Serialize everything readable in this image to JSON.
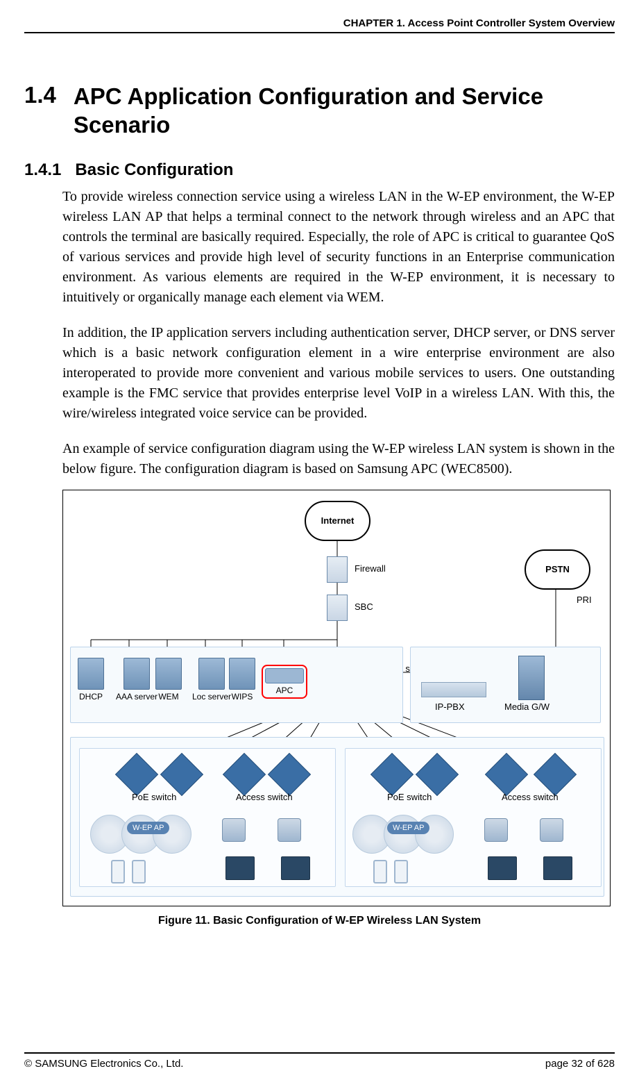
{
  "header": {
    "chapter": "CHAPTER 1. Access Point Controller System Overview"
  },
  "section": {
    "number": "1.4",
    "title": "APC Application Configuration and Service Scenario"
  },
  "subsection": {
    "number": "1.4.1",
    "title": "Basic Configuration"
  },
  "paragraphs": {
    "p1": "To provide wireless connection service using a wireless LAN in the W-EP environment, the W-EP wireless LAN AP that helps a terminal connect to the network through wireless and an APC that controls the terminal are basically required. Especially, the role of APC is critical to guarantee QoS of various services and provide high level of security functions in an Enterprise communication environment. As various elements are required in the W-EP environment, it is necessary to intuitively or organically manage each element via WEM.",
    "p2": "In addition, the IP application servers including authentication server, DHCP server, or DNS server which is a basic network configuration element in a wire enterprise environment are also interoperated to provide more convenient and various mobile services to users. One outstanding example is the FMC service that provides enterprise level VoIP in a wireless LAN. With this, the wire/wireless integrated voice service can be provided.",
    "p3": "An example of service configuration diagram using the W-EP wireless LAN system is shown in the below figure. The configuration diagram is based on Samsung APC (WEC8500)."
  },
  "figure": {
    "caption": "Figure 11. Basic Configuration of W-EP Wireless LAN System",
    "labels": {
      "internet": "Internet",
      "pstn": "PSTN",
      "pri": "PRI",
      "firewall": "Firewall",
      "sbc": "SBC",
      "backbone": "Backbone switch",
      "dhcp": "DHCP",
      "aaa": "AAA server",
      "wem": "WEM",
      "loc": "Loc server",
      "wips": "WIPS",
      "apc": "APC",
      "ippbx": "IP-PBX",
      "mediagw": "Media G/W",
      "poe": "PoE switch",
      "access": "Access switch",
      "wepap": "W-EP AP"
    }
  },
  "footer": {
    "copyright": "© SAMSUNG Electronics Co., Ltd.",
    "page": "page 32 of 628"
  }
}
